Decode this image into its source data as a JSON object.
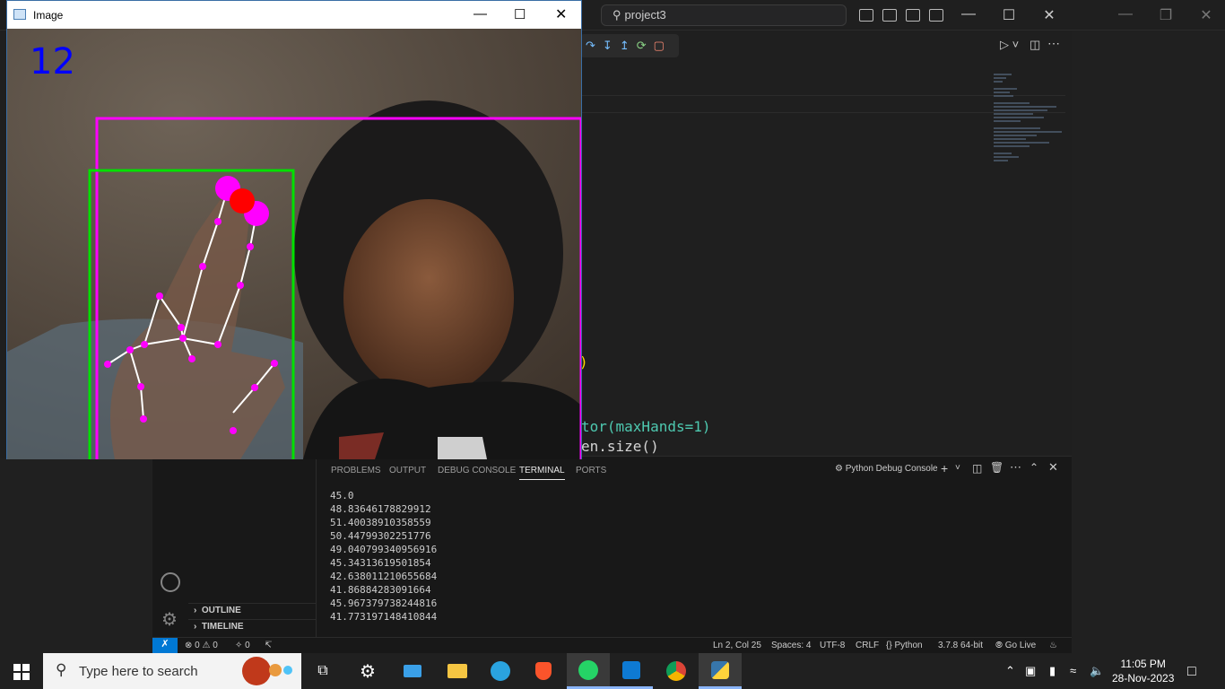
{
  "vscode": {
    "command_center": "project3",
    "code_lines": [
      "tor(maxHands=1)",
      "en.size()"
    ],
    "code_param": "maxHands=1",
    "panel_tabs": [
      "PROBLEMS",
      "OUTPUT",
      "DEBUG CONSOLE",
      "TERMINAL",
      "PORTS"
    ],
    "active_tab": "TERMINAL",
    "terminal_profile": "Python Debug Console",
    "terminal_lines": [
      "45.0",
      "48.83646178829912",
      "51.40038910358559",
      "50.44799302251776",
      "49.040799340956916",
      "45.34313619501854",
      "42.638011210655684",
      "41.86884283091664",
      "45.967379738244816",
      "41.773197148410844"
    ],
    "sidebar_sections": [
      "OUTLINE",
      "TIMELINE"
    ],
    "status": {
      "errors": "0",
      "warnings": "0",
      "ports": "0",
      "position": "Ln 2, Col 25",
      "spaces": "Spaces: 4",
      "encoding": "UTF-8",
      "eol": "CRLF",
      "language": "Python",
      "interpreter": "3.7.8 64-bit",
      "go_live": "Go Live"
    }
  },
  "image_window": {
    "title": "Image",
    "counter": "12",
    "colors": {
      "face_box": "#ff00ff",
      "hand_box": "#00ff00",
      "landmark": "#ff00ff",
      "fingertip": "#ff0000"
    }
  },
  "taskbar": {
    "search_placeholder": "Type here to search",
    "time": "11:05 PM",
    "date": "28-Nov-2023",
    "apps": [
      "task-view",
      "settings",
      "laptop",
      "file-explorer",
      "telegram",
      "brave",
      "whatsapp",
      "vscode",
      "chrome",
      "python"
    ]
  }
}
